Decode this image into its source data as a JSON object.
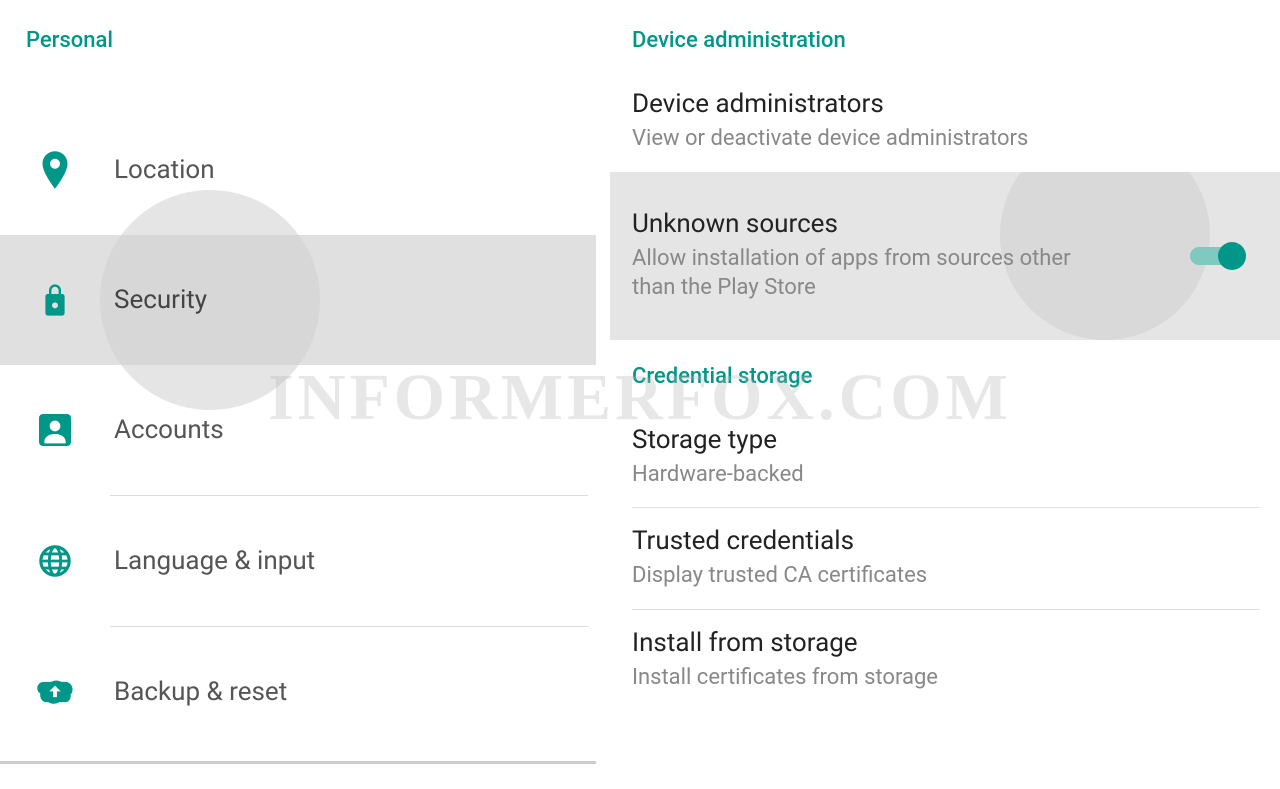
{
  "colors": {
    "accent": "#009688"
  },
  "watermark": "INFORMERFOX.COM",
  "left": {
    "header": "Personal",
    "items": [
      {
        "icon": "location-icon",
        "label": "Location",
        "selected": false
      },
      {
        "icon": "lock-icon",
        "label": "Security",
        "selected": true
      },
      {
        "icon": "account-icon",
        "label": "Accounts",
        "selected": false
      },
      {
        "icon": "globe-icon",
        "label": "Language & input",
        "selected": false
      },
      {
        "icon": "backup-icon",
        "label": "Backup & reset",
        "selected": false
      }
    ]
  },
  "right": {
    "sections": [
      {
        "header": "Device administration",
        "items": [
          {
            "title": "Device administrators",
            "subtitle": "View or deactivate device administrators"
          },
          {
            "title": "Unknown sources",
            "subtitle": "Allow installation of apps from sources other than the Play Store",
            "toggle": true,
            "highlighted": true
          }
        ]
      },
      {
        "header": "Credential storage",
        "items": [
          {
            "title": "Storage type",
            "subtitle": "Hardware-backed"
          },
          {
            "title": "Trusted credentials",
            "subtitle": "Display trusted CA certificates"
          },
          {
            "title": "Install from storage",
            "subtitle": "Install certificates from storage"
          }
        ]
      }
    ]
  }
}
